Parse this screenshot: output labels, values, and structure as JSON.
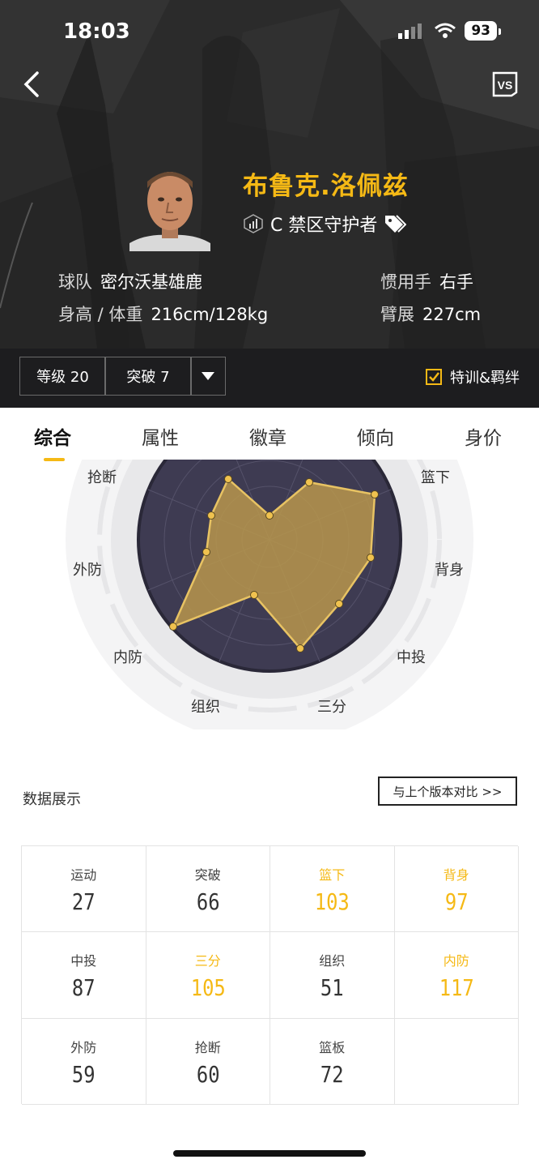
{
  "status": {
    "time": "18:03",
    "battery": "93"
  },
  "header": {
    "back_icon": "chevron-left-icon",
    "vs_icon": "vs-compare-icon"
  },
  "player": {
    "name": "布鲁克.洛佩兹",
    "role": "C 禁区守护者",
    "team_label": "球队",
    "team": "密尔沃基雄鹿",
    "hand_label": "惯用手",
    "hand": "右手",
    "hw_label": "身高 / 体重",
    "hw": "216cm/128kg",
    "wingspan_label": "臂展",
    "wingspan": "227cm"
  },
  "controls": {
    "level": "等级 20",
    "breakthrough": "突破 7",
    "checkbox_label": "特训&羁绊",
    "checked": true
  },
  "tabs": [
    "综合",
    "属性",
    "徽章",
    "倾向",
    "身价"
  ],
  "radar": {
    "labels": [
      "篮下",
      "背身",
      "中投",
      "三分",
      "组织",
      "内防",
      "外防",
      "抢断"
    ]
  },
  "section": {
    "title": "数据展示",
    "compare_button": "与上个版本对比 >>"
  },
  "stats": [
    {
      "label": "运动",
      "value": "27",
      "highlight": false
    },
    {
      "label": "突破",
      "value": "66",
      "highlight": false
    },
    {
      "label": "篮下",
      "value": "103",
      "highlight": true
    },
    {
      "label": "背身",
      "value": "97",
      "highlight": true
    },
    {
      "label": "中投",
      "value": "87",
      "highlight": false
    },
    {
      "label": "三分",
      "value": "105",
      "highlight": true
    },
    {
      "label": "组织",
      "value": "51",
      "highlight": false
    },
    {
      "label": "内防",
      "value": "117",
      "highlight": true
    },
    {
      "label": "外防",
      "value": "59",
      "highlight": false
    },
    {
      "label": "抢断",
      "value": "60",
      "highlight": false
    },
    {
      "label": "篮板",
      "value": "72",
      "highlight": false
    }
  ],
  "colors": {
    "accent": "#f5b915",
    "dark": "#1d1d1f"
  }
}
